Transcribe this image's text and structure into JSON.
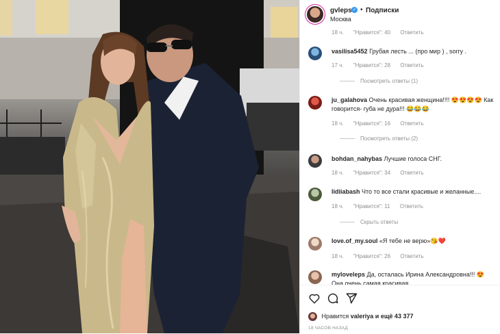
{
  "post": {
    "username": "gvleps",
    "verified_mark": "✓",
    "dot": "•",
    "follow_label": "Подписки",
    "location": "Москва"
  },
  "comments": [
    {
      "partial_meta": true,
      "time": "18 ч.",
      "likes": "\"Нравится\": 40",
      "reply": "Ответить"
    },
    {
      "user": "vasilisa5452",
      "text": "Грубая лесть ... (про мир ) , sorry .",
      "time": "17 ч.",
      "likes": "\"Нравится\": 28",
      "reply": "Ответить",
      "replies_label": "Посмотреть ответы (1)"
    },
    {
      "user": "ju_galahova",
      "text": "Очень красивая женщина!!!! 😍😍😍😍 Как говорится- губа не дура!!! 😂😂😂",
      "time": "18 ч.",
      "likes": "\"Нравится\": 16",
      "reply": "Ответить",
      "replies_label": "Посмотреть ответы (2)"
    },
    {
      "user": "bohdan_nahybas",
      "text": "Лучшие голоса СНГ.",
      "time": "18 ч.",
      "likes": "\"Нравится\": 34",
      "reply": "Ответить"
    },
    {
      "user": "lidiiabash",
      "text": "Что то все стали красивые и желанные....",
      "time": "18 ч.",
      "likes": "\"Нравится\": 11",
      "reply": "Ответить",
      "replies_label": "Скрыть ответы"
    },
    {
      "user": "love.of_my.soul",
      "text": "«Я тебе не верю»😘❤️",
      "time": "18 ч.",
      "likes": "\"Нравится\": 26",
      "reply": "Ответить"
    },
    {
      "user": "myloveleps",
      "text": "Да, осталась Ирина Александровна!!! 😍 Она очень самая красивая"
    }
  ],
  "actions": {
    "like_icon": "heart-icon",
    "comment_icon": "comment-icon",
    "share_icon": "share-icon",
    "likes_prefix": "Нравится",
    "likes_user": "valeriya",
    "likes_suffix": "и ещё 43 377",
    "time_ago": "18 ЧАСОВ НАЗАД"
  },
  "colors": {
    "verified": "#3897f0",
    "muted": "#8e8e8e",
    "text": "#262626"
  }
}
